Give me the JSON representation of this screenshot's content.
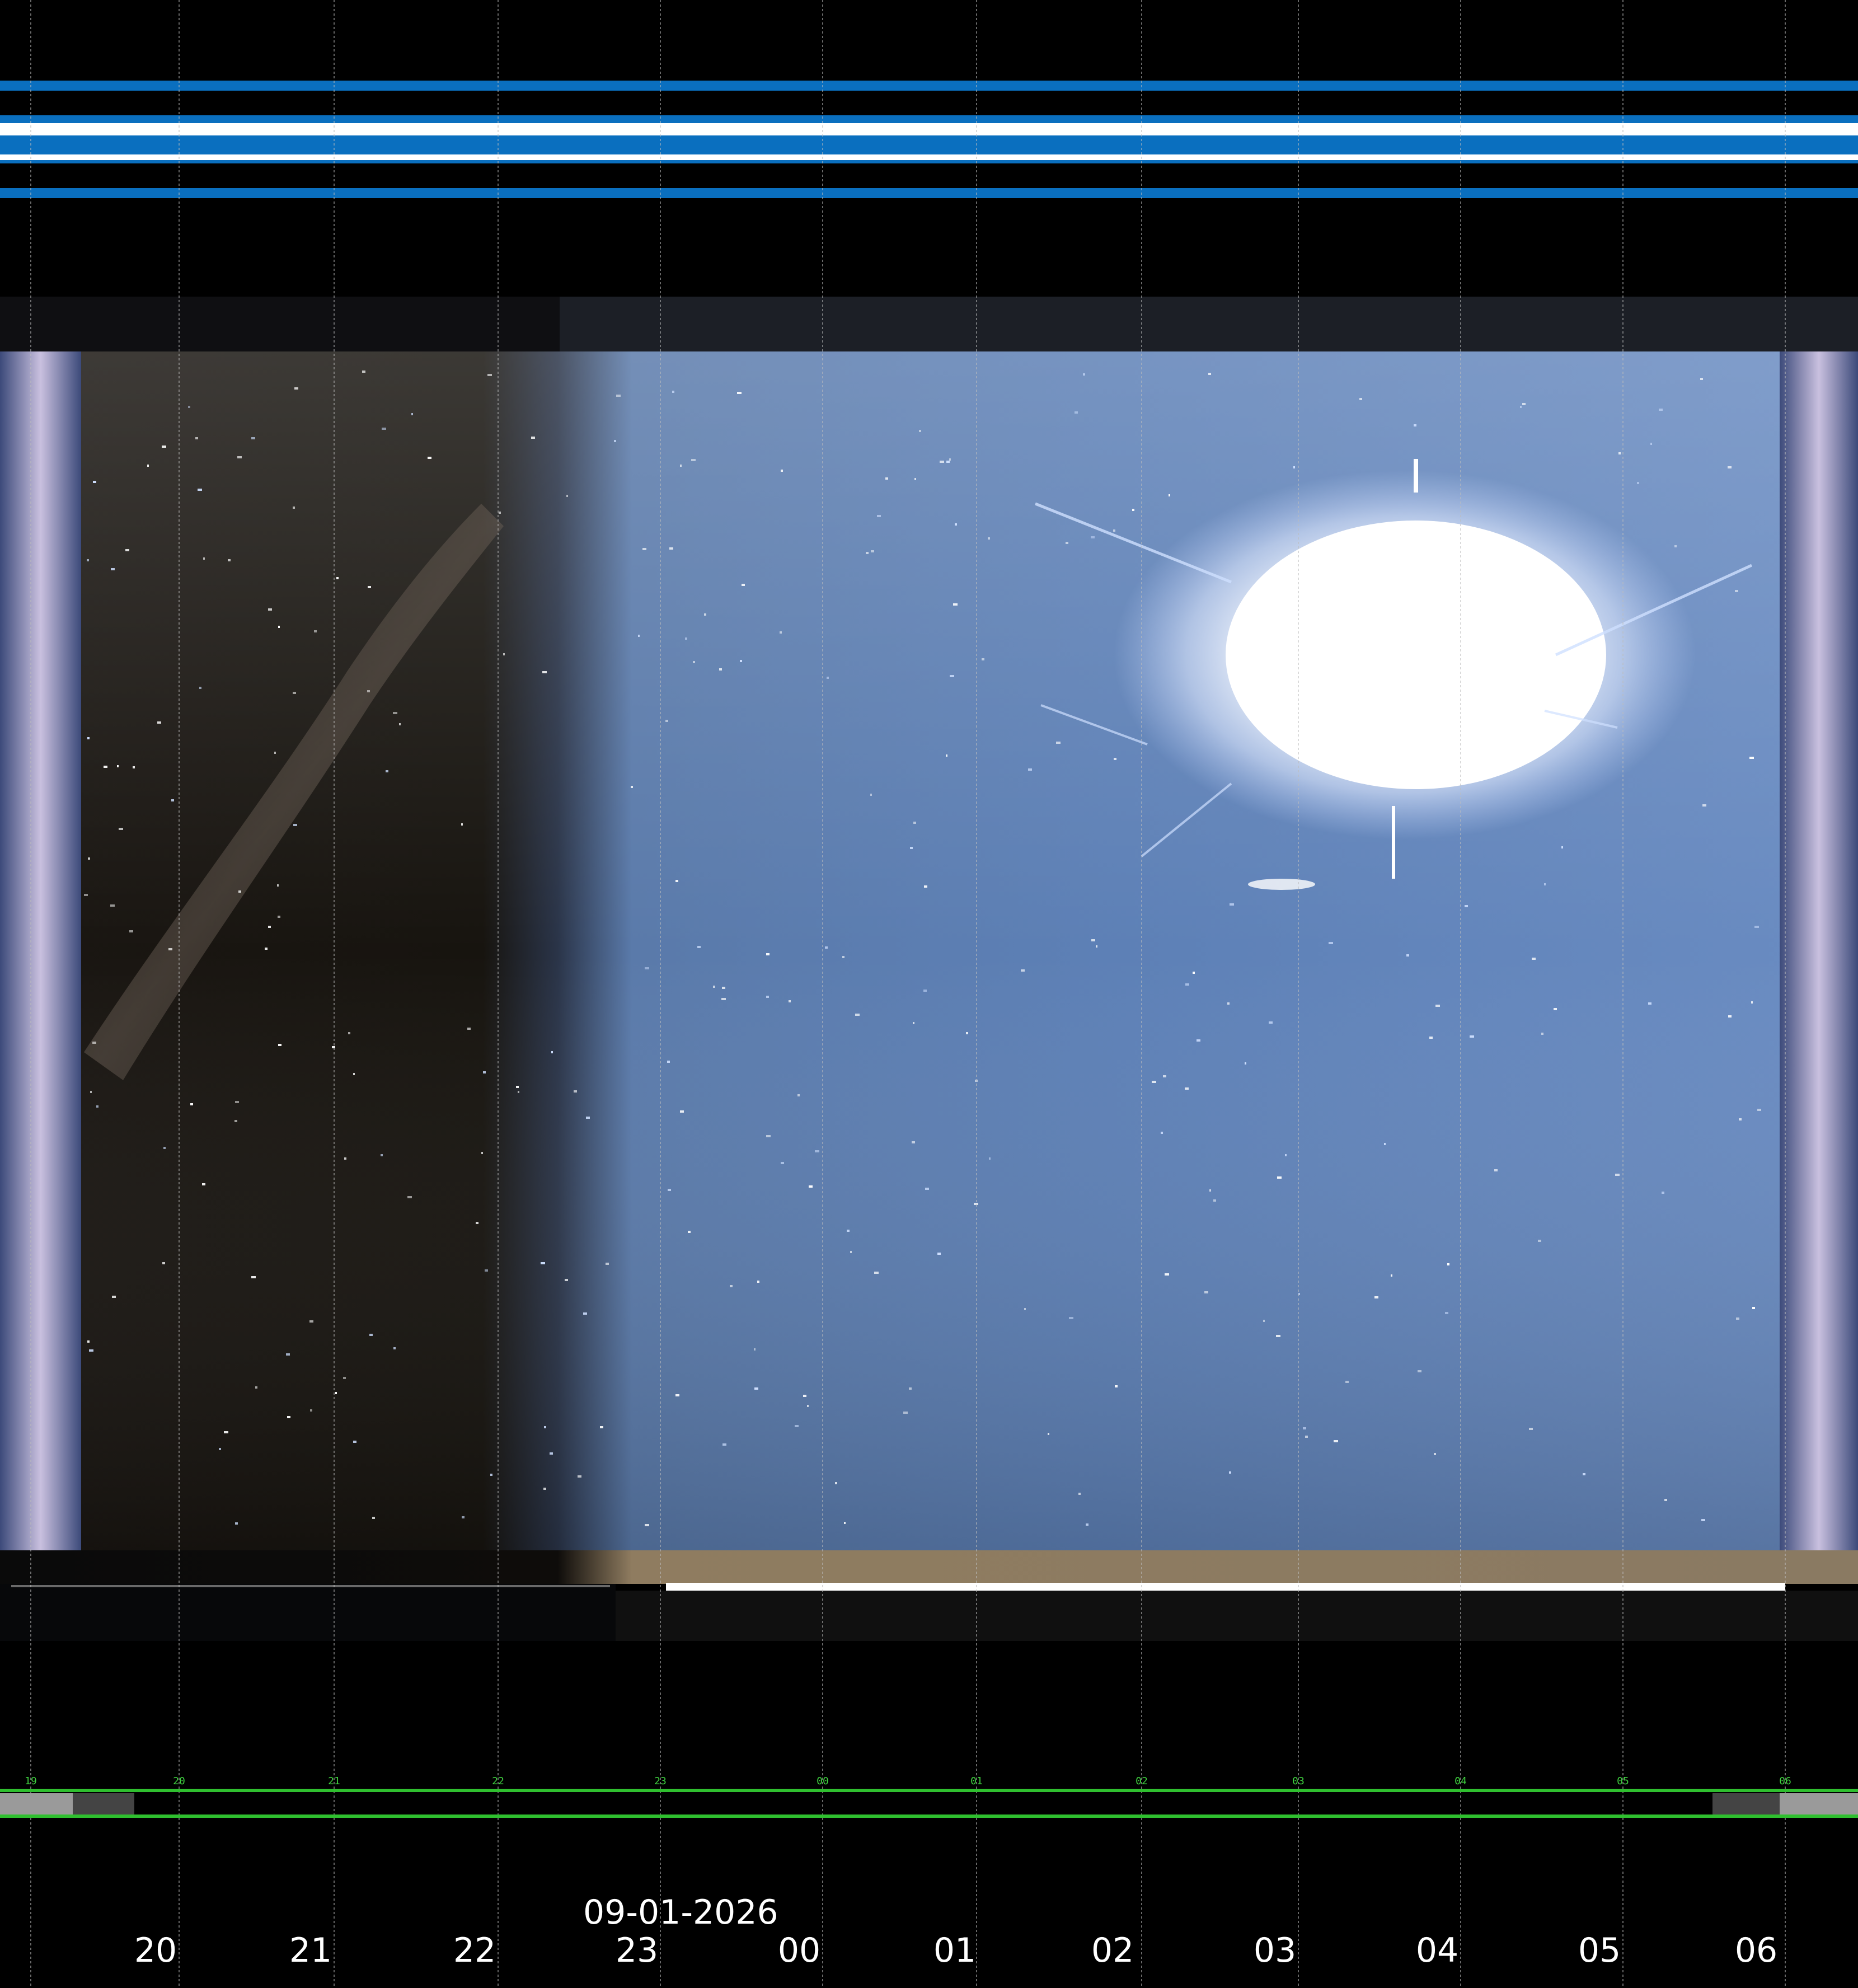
{
  "date": "09-01-2026",
  "hours": [
    "20",
    "21",
    "22",
    "23",
    "00",
    "01",
    "02",
    "03",
    "04",
    "05",
    "06"
  ],
  "tiny_hours": [
    "19",
    "20",
    "21",
    "22",
    "23",
    "00",
    "01",
    "02",
    "03",
    "04",
    "05",
    "06"
  ],
  "colors": {
    "background": "#000000",
    "band_blue": "#0a6fbf",
    "band_white": "#ffffff",
    "timeline_green": "#2fbf2f",
    "night_sky": "#14110d",
    "day_sky": "#5a7fb4",
    "sun": "#ffffff",
    "ground": "#8a7a62"
  },
  "icons": [
    "sun-glare",
    "milky-way",
    "stars"
  ]
}
